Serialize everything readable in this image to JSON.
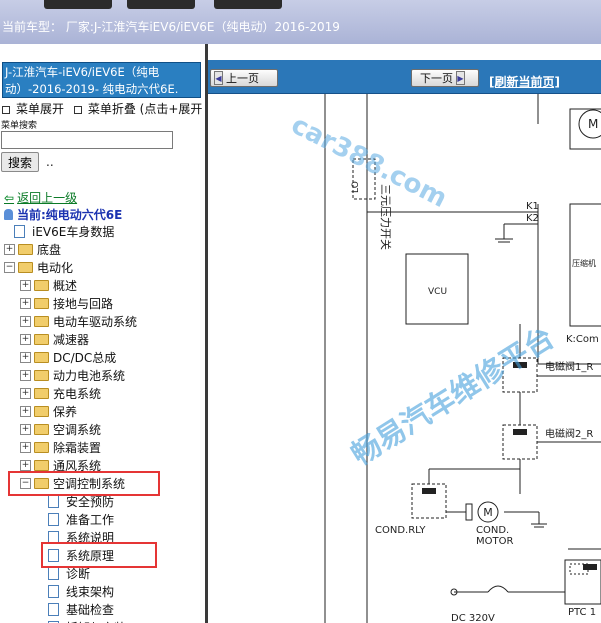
{
  "header": {
    "current_car_label": "当前车型：",
    "current_car_value": "厂家:J-江淮汽车iEV6/iEV6E（纯电动）2016-2019"
  },
  "sidebar": {
    "model_title_line1": "J-江淮汽车-iEV6/iEV6E（纯电",
    "model_title_line2": "动）-2016-2019- 纯电动六代6E.",
    "expand_label": "菜单展开",
    "collapse_label": "菜单折叠 (点击+展开",
    "search_label": "菜单搜索",
    "search_placeholder": "",
    "search_button": "搜索",
    "search_trailing": "..",
    "back_label": "返回上一级",
    "current_label": "当前:纯电动六代6E",
    "tree": [
      {
        "label": "iEV6E车身数据",
        "type": "doc",
        "level": 0
      },
      {
        "label": "底盘",
        "type": "folder",
        "level": 0,
        "state": "+"
      },
      {
        "label": "电动化",
        "type": "folder",
        "level": 0,
        "state": "-"
      },
      {
        "label": "概述",
        "type": "folder",
        "level": 1,
        "state": "+"
      },
      {
        "label": "接地与回路",
        "type": "folder",
        "level": 1,
        "state": "+"
      },
      {
        "label": "电动车驱动系统",
        "type": "folder",
        "level": 1,
        "state": "+"
      },
      {
        "label": "减速器",
        "type": "folder",
        "level": 1,
        "state": "+"
      },
      {
        "label": "DC/DC总成",
        "type": "folder",
        "level": 1,
        "state": "+"
      },
      {
        "label": "动力电池系统",
        "type": "folder",
        "level": 1,
        "state": "+"
      },
      {
        "label": "充电系统",
        "type": "folder",
        "level": 1,
        "state": "+"
      },
      {
        "label": "保养",
        "type": "folder",
        "level": 1,
        "state": "+"
      },
      {
        "label": "空调系统",
        "type": "folder",
        "level": 1,
        "state": "+"
      },
      {
        "label": "除霜装置",
        "type": "folder",
        "level": 1,
        "state": "+"
      },
      {
        "label": "通风系统",
        "type": "folder",
        "level": 1,
        "state": "+"
      },
      {
        "label": "空调控制系统",
        "type": "folder",
        "level": 1,
        "state": "-"
      },
      {
        "label": "安全预防",
        "type": "doc",
        "level": 2
      },
      {
        "label": "准备工作",
        "type": "doc",
        "level": 2
      },
      {
        "label": "系统说明",
        "type": "doc",
        "level": 2
      },
      {
        "label": "系统原理",
        "type": "doc",
        "level": 2
      },
      {
        "label": "诊断",
        "type": "doc",
        "level": 2
      },
      {
        "label": "线束架构",
        "type": "doc",
        "level": 2
      },
      {
        "label": "基础检查",
        "type": "doc",
        "level": 2
      },
      {
        "label": "拆卸与安装",
        "type": "doc",
        "level": 2
      }
    ]
  },
  "nav": {
    "prev_label": "上一页",
    "next_label": "下一页",
    "refresh_label": "[刷新当前页]"
  },
  "diagram": {
    "labels": {
      "pressure_switch": "三元压力开关",
      "k1": "K1",
      "k2": "K2",
      "compressor_ctrl": "压缩机",
      "k_comp": "K:Com",
      "vcu": "VCU",
      "valve1": "电磁阀1_R",
      "valve2": "电磁阀2_R",
      "cond_rly": "COND.RLY",
      "cond_motor_1": "COND.",
      "cond_motor_2": "MOTOR",
      "motor_symbol": "M",
      "m_top": "M",
      "dc": "DC 320V",
      "ptc": "PTC 1",
      "pressure_tag": "LO"
    }
  },
  "watermarks": {
    "site": "car388.com",
    "platform": "畅易汽车维修平台"
  },
  "colors": {
    "title_bg": "#2a7fc1",
    "nav_bg": "#2b77b8",
    "highlight": "#e53535",
    "current_text": "#1a32b0",
    "back_text": "#0a7a26"
  }
}
